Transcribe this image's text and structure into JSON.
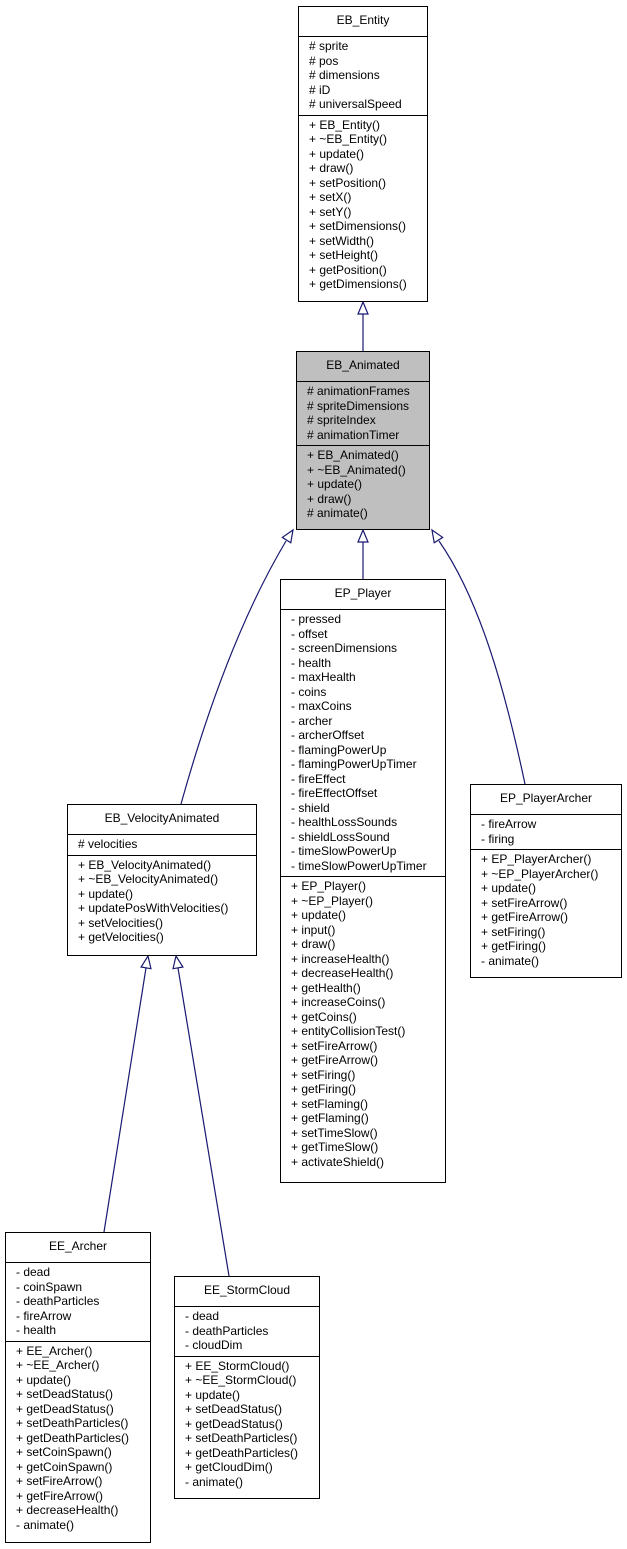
{
  "diagram": {
    "type": "uml-class-inheritance",
    "classes": [
      {
        "id": "EB_Entity",
        "name": "EB_Entity",
        "highlighted": false,
        "attributes": [
          "# sprite",
          "# pos",
          "# dimensions",
          "# iD",
          "# universalSpeed"
        ],
        "methods": [
          "+ EB_Entity()",
          "+ ~EB_Entity()",
          "+ update()",
          "+ draw()",
          "+ setPosition()",
          "+ setX()",
          "+ setY()",
          "+ setDimensions()",
          "+ setWidth()",
          "+ setHeight()",
          "+ getPosition()",
          "+ getDimensions()"
        ]
      },
      {
        "id": "EB_Animated",
        "name": "EB_Animated",
        "highlighted": true,
        "attributes": [
          "# animationFrames",
          "# spriteDimensions",
          "# spriteIndex",
          "# animationTimer"
        ],
        "methods": [
          "+ EB_Animated()",
          "+ ~EB_Animated()",
          "+ update()",
          "+ draw()",
          "# animate()"
        ]
      },
      {
        "id": "EP_Player",
        "name": "EP_Player",
        "highlighted": false,
        "attributes": [
          "- pressed",
          "- offset",
          "- screenDimensions",
          "- health",
          "- maxHealth",
          "- coins",
          "- maxCoins",
          "- archer",
          "- archerOffset",
          "- flamingPowerUp",
          "- flamingPowerUpTimer",
          "- fireEffect",
          "- fireEffectOffset",
          "- shield",
          "- healthLossSounds",
          "- shieldLossSound",
          "- timeSlowPowerUp",
          "- timeSlowPowerUpTimer"
        ],
        "methods": [
          "+ EP_Player()",
          "+ ~EP_Player()",
          "+ update()",
          "+ input()",
          "+ draw()",
          "+ increaseHealth()",
          "+ decreaseHealth()",
          "+ getHealth()",
          "+ increaseCoins()",
          "+ getCoins()",
          "+ entityCollisionTest()",
          "+ setFireArrow()",
          "+ getFireArrow()",
          "+ setFiring()",
          "+ getFiring()",
          "+ setFlaming()",
          "+ getFlaming()",
          "+ setTimeSlow()",
          "+ getTimeSlow()",
          "+ activateShield()"
        ]
      },
      {
        "id": "EP_PlayerArcher",
        "name": "EP_PlayerArcher",
        "highlighted": false,
        "attributes": [
          "- fireArrow",
          "- firing"
        ],
        "methods": [
          "+ EP_PlayerArcher()",
          "+ ~EP_PlayerArcher()",
          "+ update()",
          "+ setFireArrow()",
          "+ getFireArrow()",
          "+ setFiring()",
          "+ getFiring()",
          "- animate()"
        ]
      },
      {
        "id": "EB_VelocityAnimated",
        "name": "EB_VelocityAnimated",
        "highlighted": false,
        "attributes": [
          "# velocities"
        ],
        "methods": [
          "+ EB_VelocityAnimated()",
          "+ ~EB_VelocityAnimated()",
          "+ update()",
          "+ updatePosWithVelocities()",
          "+ setVelocities()",
          "+ getVelocities()"
        ]
      },
      {
        "id": "EE_Archer",
        "name": "EE_Archer",
        "highlighted": false,
        "attributes": [
          "- dead",
          "- coinSpawn",
          "- deathParticles",
          "- fireArrow",
          "- health"
        ],
        "methods": [
          "+ EE_Archer()",
          "+ ~EE_Archer()",
          "+ update()",
          "+ setDeadStatus()",
          "+ getDeadStatus()",
          "+ setDeathParticles()",
          "+ getDeathParticles()",
          "+ setCoinSpawn()",
          "+ getCoinSpawn()",
          "+ setFireArrow()",
          "+ getFireArrow()",
          "+ decreaseHealth()",
          "- animate()"
        ]
      },
      {
        "id": "EE_StormCloud",
        "name": "EE_StormCloud",
        "highlighted": false,
        "attributes": [
          "- dead",
          "- deathParticles",
          "- cloudDim"
        ],
        "methods": [
          "+ EE_StormCloud()",
          "+ ~EE_StormCloud()",
          "+ update()",
          "+ setDeadStatus()",
          "+ getDeadStatus()",
          "+ setDeathParticles()",
          "+ getDeathParticles()",
          "+ getCloudDim()",
          "- animate()"
        ]
      }
    ],
    "inheritance": [
      {
        "child": "EB_Animated",
        "parent": "EB_Entity"
      },
      {
        "child": "EB_VelocityAnimated",
        "parent": "EB_Animated"
      },
      {
        "child": "EP_Player",
        "parent": "EB_Animated"
      },
      {
        "child": "EP_PlayerArcher",
        "parent": "EB_Animated"
      },
      {
        "child": "EE_Archer",
        "parent": "EB_VelocityAnimated"
      },
      {
        "child": "EE_StormCloud",
        "parent": "EB_VelocityAnimated"
      }
    ],
    "colors": {
      "edge": "#191970",
      "highlight_fill": "#bfbfbf",
      "box_border": "#000000"
    }
  }
}
